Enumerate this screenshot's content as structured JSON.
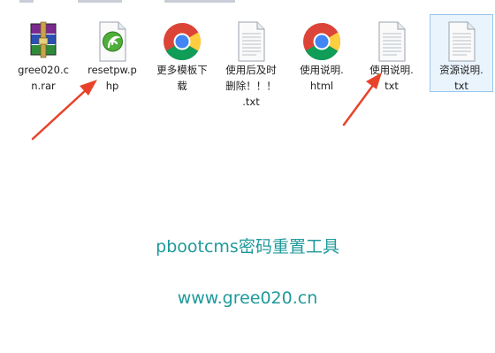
{
  "colors": {
    "accent_text": "#1e9a9a",
    "arrow": "#e8432a",
    "selection_border": "#99c6ee",
    "selection_fill": "#eaf4fd"
  },
  "files": [
    {
      "line1": "gree020.c",
      "line2": "n.rar",
      "line3": "",
      "icon": "winrar-archive-icon"
    },
    {
      "line1": "resetpw.p",
      "line2": "hp",
      "line3": "",
      "icon": "php-file-icon"
    },
    {
      "line1": "更多模板下",
      "line2": "载",
      "line3": "",
      "icon": "chrome-icon"
    },
    {
      "line1": "使用后及时",
      "line2": "删除！！！",
      "line3": ".txt",
      "icon": "text-file-icon"
    },
    {
      "line1": "使用说明.",
      "line2": "html",
      "line3": "",
      "icon": "chrome-icon"
    },
    {
      "line1": "使用说明.",
      "line2": "txt",
      "line3": "",
      "icon": "text-file-icon"
    },
    {
      "line1": "资源说明.",
      "line2": "txt",
      "line3": "",
      "icon": "text-file-icon"
    }
  ],
  "overlay": {
    "title": "pbootcms密码重置工具",
    "website": "www.gree020.cn"
  }
}
